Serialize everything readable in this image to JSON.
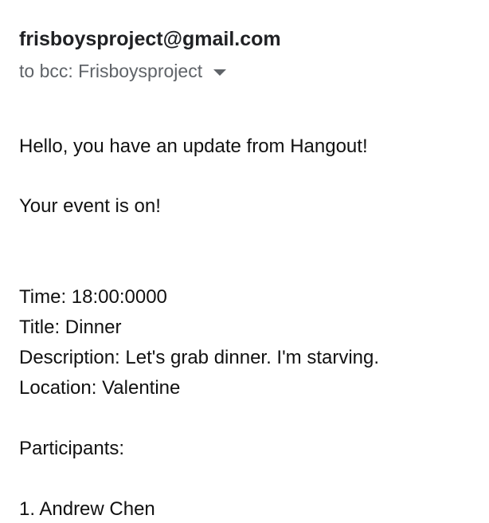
{
  "email": {
    "sender": "frisboysproject@gmail.com",
    "recipients": "to bcc: Frisboysproject",
    "greeting": "Hello, you have an update from Hangout!",
    "status_line": "Your event is on!",
    "time_line": "Time: 18:00:0000",
    "title_line": "Title: Dinner",
    "description_line": "Description: Let's grab dinner. I'm starving.",
    "location_line": "Location: Valentine",
    "participants_heading": "Participants:",
    "participants": [
      "1. Andrew Chen"
    ]
  }
}
